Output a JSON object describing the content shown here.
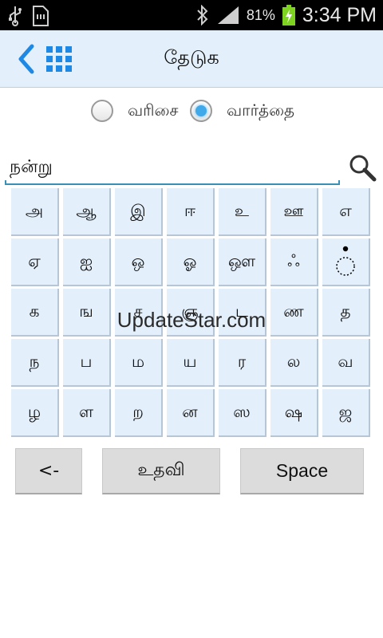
{
  "status_bar": {
    "battery_percent": "81%",
    "time": "3:34 PM",
    "icons": [
      "usb-icon",
      "sd-card-icon",
      "bluetooth-icon",
      "signal-icon",
      "battery-charging-icon"
    ]
  },
  "action_bar": {
    "title": "தேடுக",
    "back_icon": "chevron-left-icon",
    "menu_icon": "grid-menu-icon"
  },
  "search_mode": {
    "options": [
      {
        "label": "வரிசை",
        "checked": false
      },
      {
        "label": "வார்த்தை",
        "checked": true
      }
    ]
  },
  "search": {
    "value": "நன்று",
    "icon": "search-icon"
  },
  "keyboard": {
    "rows": [
      [
        "அ",
        "ஆ",
        "இ",
        "ஈ",
        "உ",
        "ஊ",
        "எ"
      ],
      [
        "ஏ",
        "ஐ",
        "ஒ",
        "ஓ",
        "ஔ",
        "ஃ",
        "்"
      ],
      [
        "க",
        "ங",
        "ச",
        "ஞ",
        "ட",
        "ண",
        "த"
      ],
      [
        "ந",
        "ப",
        "ம",
        "ய",
        "ர",
        "ல",
        "வ"
      ],
      [
        "ழ",
        "ள",
        "ற",
        "ன",
        "ஸ",
        "ஷ",
        "ஜ"
      ]
    ]
  },
  "watermark": "UpdateStar.com",
  "buttons": {
    "backspace": "<-",
    "help": "உதவி",
    "space": "Space"
  },
  "colors": {
    "accent": "#1e88e5",
    "key_bg": "#e3effb",
    "action_bar_bg": "#e3f0fb",
    "radio_checked": "#3fa9ea"
  }
}
